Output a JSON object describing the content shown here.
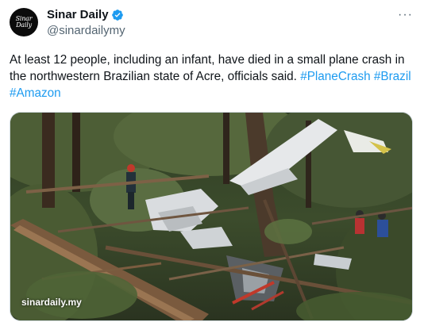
{
  "tweet": {
    "avatar_text_line1": "Sinar",
    "avatar_text_line2": "Daily",
    "display_name": "Sinar Daily",
    "handle": "@sinardailymy",
    "more_label": "···",
    "text": "At least 12 people, including an infant, have died in a small plane crash in the northwestern Brazilian state of Acre, officials said.",
    "hashtags": [
      "#PlaneCrash",
      "#Brazil",
      "#Amazon"
    ],
    "verified_icon": "verified-badge-icon",
    "image_watermark": "sinardaily.my"
  },
  "colors": {
    "accent": "#1d9bf0",
    "text": "#0f1419",
    "secondary": "#536471"
  }
}
